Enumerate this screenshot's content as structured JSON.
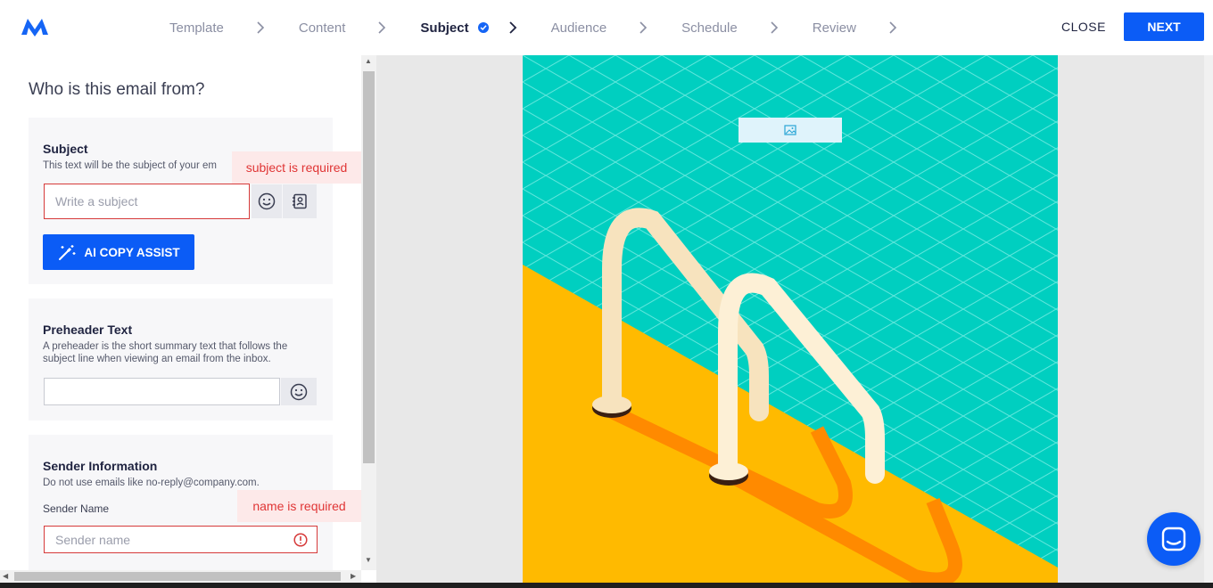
{
  "topbar": {
    "steps": [
      {
        "label": "Template"
      },
      {
        "label": "Content"
      },
      {
        "label": "Subject"
      },
      {
        "label": "Audience"
      },
      {
        "label": "Schedule"
      },
      {
        "label": "Review"
      }
    ],
    "active_step": "Subject",
    "close_label": "CLOSE",
    "next_label": "NEXT"
  },
  "form": {
    "heading": "Who is this email from?",
    "subject": {
      "title": "Subject",
      "description": "This text will be the subject of your em",
      "placeholder": "Write a subject",
      "error": "subject is required",
      "ai_button_label": "AI COPY ASSIST"
    },
    "preheader": {
      "title": "Preheader Text",
      "description": "A preheader is the short summary text that follows the subject line when viewing an email from the inbox.",
      "value": ""
    },
    "sender": {
      "title": "Sender Information",
      "description": "Do not use emails like no-reply@company.com.",
      "name_label": "Sender Name",
      "name_placeholder": "Sender name",
      "name_error": "name is required"
    }
  },
  "colors": {
    "accent": "#0b5cf6",
    "error": "#e03535",
    "pool_water": "#00cfc0",
    "pool_deck": "#ffba00"
  }
}
